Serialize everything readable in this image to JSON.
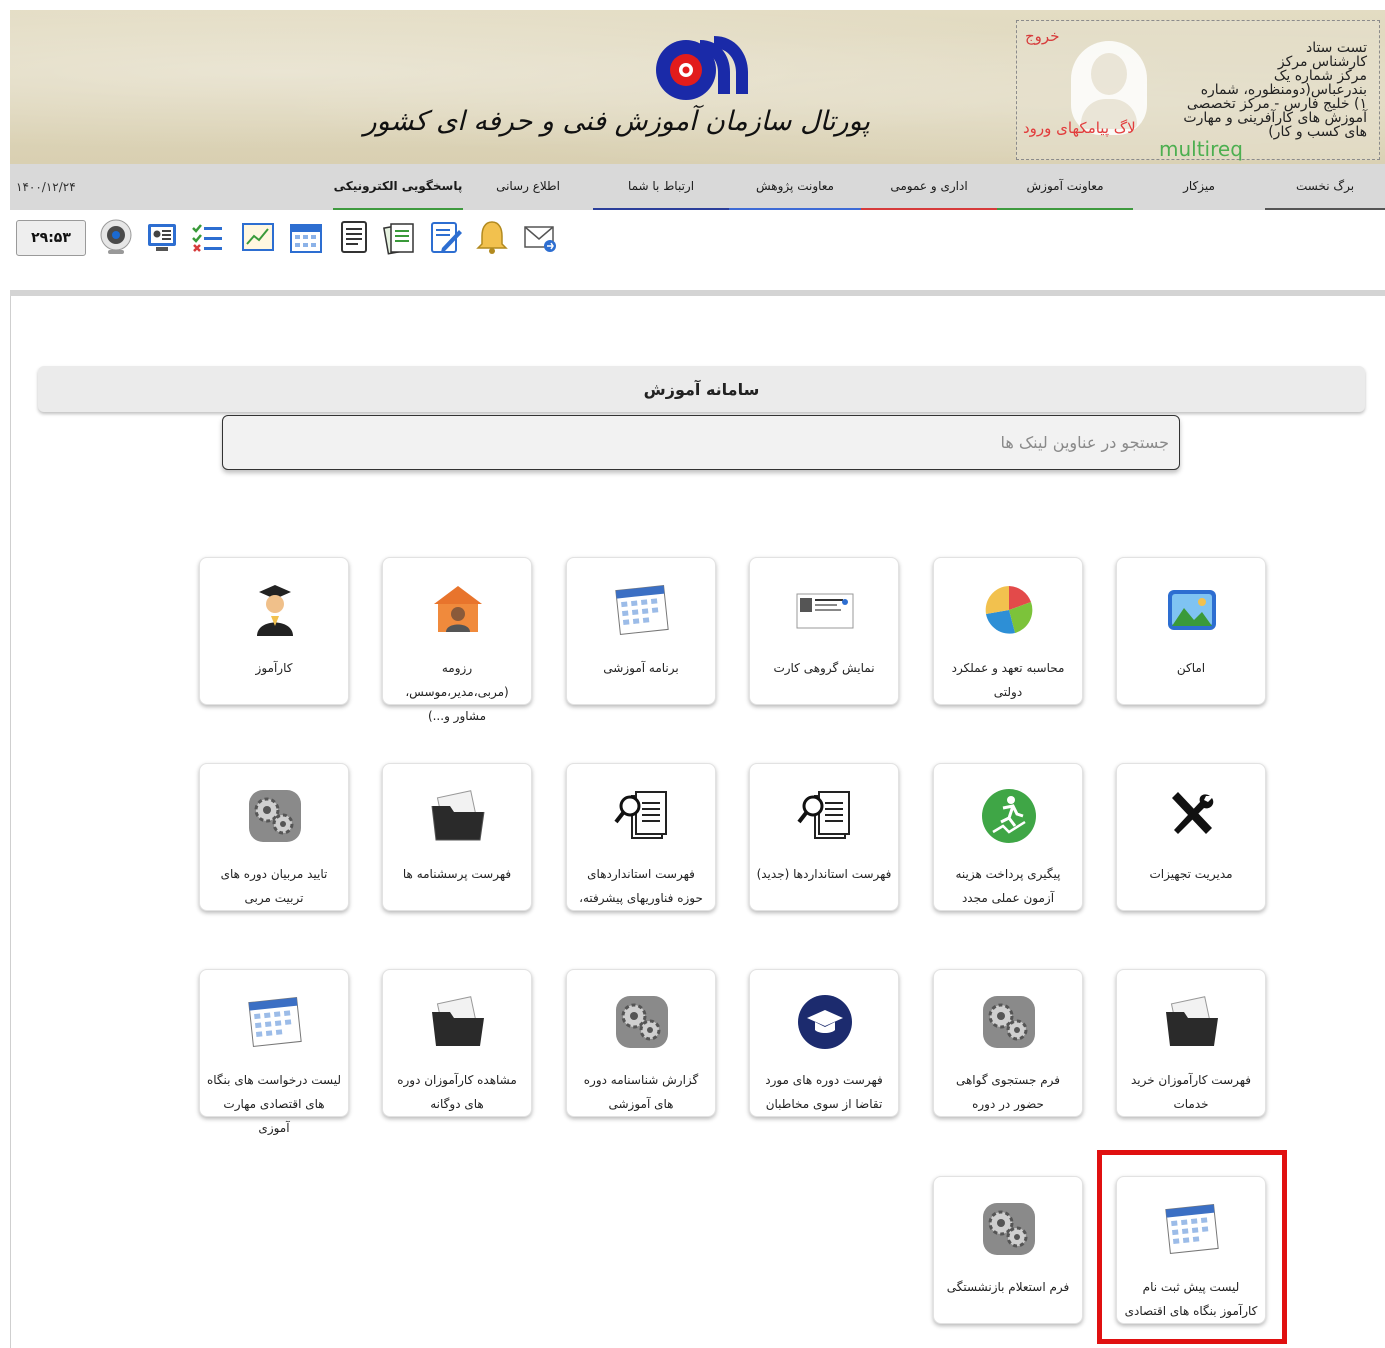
{
  "header": {
    "portal_title": "پورتال سازمان آموزش فنی و حرفه ای کشور",
    "user_lines": [
      "تست ستاد",
      "کارشناس مرکز",
      "مرکز شماره یک",
      "بندرعباس(دومنظوره، شماره",
      "۱) خلیج فارس - مرکز تخصصی",
      "آموزش های کارآفرینی و مهارت",
      "های کسب و کار)"
    ],
    "logout": "خروج",
    "sms_log": "لاگ پیامکهای ورود",
    "multireq": "multireq"
  },
  "nav": {
    "date": "۱۴۰۰/۱۲/۲۴",
    "items": [
      "برگ نخست",
      "میزکار",
      "معاونت آموزش",
      "اداری و عمومی",
      "معاونت پژوهش",
      "ارتباط با شما",
      "اطلاع رسانی",
      "پاسخگویی الکترونیکی"
    ]
  },
  "toolbar": {
    "timer": "۲۹:۵۳",
    "icons": [
      "webcam-icon",
      "support-agent-icon",
      "checklist-icon",
      "chart-report-icon",
      "calendar-icon",
      "document-icon",
      "stacked-papers-icon",
      "edit-note-icon",
      "notification-bell-icon",
      "mail-forward-icon"
    ]
  },
  "main": {
    "system_title": "سامانه آموزش",
    "search_placeholder": "جستجو در عناوین لینک ها"
  },
  "tiles": [
    {
      "label": "اماکن",
      "icon": "landscape-photo-icon"
    },
    {
      "label": "محاسبه تعهد و عملکرد دولتی",
      "icon": "pie-chart-icon"
    },
    {
      "label": "نمایش گروهی کارت",
      "icon": "id-card-icon"
    },
    {
      "label": "برنامه آموزشی",
      "icon": "calendar-icon"
    },
    {
      "label": "رزومه (مربی،مدیر،موسس، مشاور و...)",
      "icon": "person-house-icon"
    },
    {
      "label": "کارآموز",
      "icon": "graduate-icon"
    },
    {
      "label": "مدیریت تجهیزات",
      "icon": "tools-icon"
    },
    {
      "label": "پیگیری پرداخت هزینه آزمون عملی مجدد",
      "icon": "progress-runner-icon"
    },
    {
      "label": "فهرست استانداردها (جدید)",
      "icon": "document-search-icon"
    },
    {
      "label": "فهرست استانداردهای حوزه فناوریهای پیشرفته،",
      "icon": "document-search-icon"
    },
    {
      "label": "فهرست پرسشنامه ها",
      "icon": "folder-icon"
    },
    {
      "label": "تایید مربیان دوره های تربیت مربی",
      "icon": "gears-icon"
    },
    {
      "label": "فهرست کارآموزان خرید خدمات",
      "icon": "folder-icon"
    },
    {
      "label": "فرم جستجوی گواهی حضور در دوره",
      "icon": "gears-icon"
    },
    {
      "label": "فهرست دوره های مورد تقاضا از سوی مخاطبان",
      "icon": "graduation-cap-icon"
    },
    {
      "label": "گزارش شناسنامه دوره های آموزشی",
      "icon": "gears-icon"
    },
    {
      "label": "مشاهده کارآموزان دوره های دوگانه",
      "icon": "folder-icon"
    },
    {
      "label": "لیست درخواست های بنگاه های اقتصادی مهارت آموزی",
      "icon": "calendar-icon"
    },
    {
      "label": "لیست پیش ثبت نام کارآموز بنگاه های اقتصادی",
      "icon": "calendar-icon"
    },
    {
      "label": "فرم استعلام بازنشستگی",
      "icon": "gears-icon"
    }
  ],
  "highlighted_tile": "لیست پیش ثبت نام کارآموز بنگاه های اقتصادی"
}
